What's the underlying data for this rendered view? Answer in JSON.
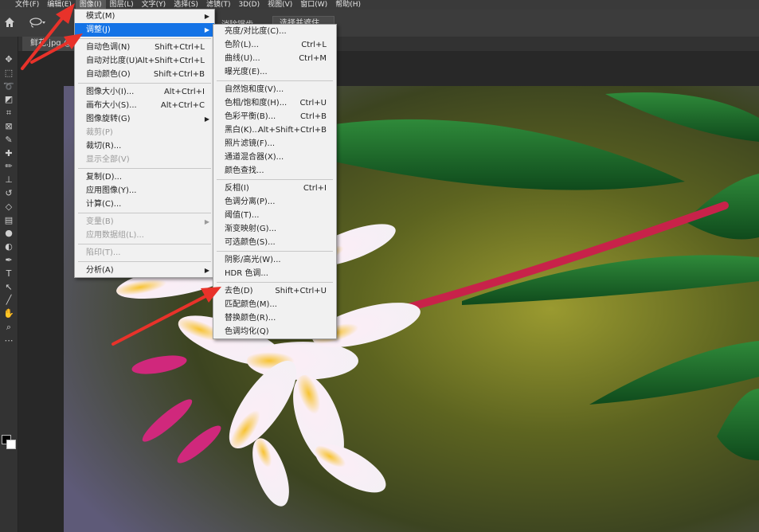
{
  "menubar": {
    "items": [
      "文件(F)",
      "编辑(E)",
      "图像(I)",
      "图层(L)",
      "文字(Y)",
      "选择(S)",
      "滤镜(T)",
      "3D(D)",
      "视图(V)",
      "窗口(W)",
      "帮助(H)"
    ]
  },
  "options_bar": {
    "partial_label": "消除锯齿",
    "select_mask_button": "选择并遮住..."
  },
  "document_tab": {
    "title": "鲜花.jpg @"
  },
  "image_menu": {
    "items": [
      {
        "label": "模式(M)",
        "shortcut": "",
        "submenu": true
      },
      {
        "label": "调整(J)",
        "shortcut": "",
        "submenu": true,
        "highlighted": true
      },
      {
        "sep": true
      },
      {
        "label": "自动色调(N)",
        "shortcut": "Shift+Ctrl+L"
      },
      {
        "label": "自动对比度(U)",
        "shortcut": "Alt+Shift+Ctrl+L"
      },
      {
        "label": "自动颜色(O)",
        "shortcut": "Shift+Ctrl+B"
      },
      {
        "sep": true
      },
      {
        "label": "图像大小(I)...",
        "shortcut": "Alt+Ctrl+I"
      },
      {
        "label": "画布大小(S)...",
        "shortcut": "Alt+Ctrl+C"
      },
      {
        "label": "图像旋转(G)",
        "shortcut": "",
        "submenu": true
      },
      {
        "label": "裁剪(P)",
        "shortcut": "",
        "disabled": true
      },
      {
        "label": "裁切(R)...",
        "shortcut": ""
      },
      {
        "label": "显示全部(V)",
        "shortcut": "",
        "disabled": true
      },
      {
        "sep": true
      },
      {
        "label": "复制(D)...",
        "shortcut": ""
      },
      {
        "label": "应用图像(Y)...",
        "shortcut": ""
      },
      {
        "label": "计算(C)...",
        "shortcut": ""
      },
      {
        "sep": true
      },
      {
        "label": "变量(B)",
        "shortcut": "",
        "submenu": true,
        "disabled": true
      },
      {
        "label": "应用数据组(L)...",
        "shortcut": "",
        "disabled": true
      },
      {
        "sep": true
      },
      {
        "label": "陷印(T)...",
        "shortcut": "",
        "disabled": true
      },
      {
        "sep": true
      },
      {
        "label": "分析(A)",
        "shortcut": "",
        "submenu": true
      }
    ]
  },
  "adjust_menu": {
    "items": [
      {
        "label": "亮度/对比度(C)...",
        "shortcut": ""
      },
      {
        "label": "色阶(L)...",
        "shortcut": "Ctrl+L"
      },
      {
        "label": "曲线(U)...",
        "shortcut": "Ctrl+M"
      },
      {
        "label": "曝光度(E)...",
        "shortcut": ""
      },
      {
        "sep": true
      },
      {
        "label": "自然饱和度(V)...",
        "shortcut": ""
      },
      {
        "label": "色相/饱和度(H)...",
        "shortcut": "Ctrl+U"
      },
      {
        "label": "色彩平衡(B)...",
        "shortcut": "Ctrl+B"
      },
      {
        "label": "黑白(K)...",
        "shortcut": "Alt+Shift+Ctrl+B"
      },
      {
        "label": "照片滤镜(F)...",
        "shortcut": ""
      },
      {
        "label": "通道混合器(X)...",
        "shortcut": ""
      },
      {
        "label": "颜色查找...",
        "shortcut": ""
      },
      {
        "sep": true
      },
      {
        "label": "反相(I)",
        "shortcut": "Ctrl+I"
      },
      {
        "label": "色调分离(P)...",
        "shortcut": ""
      },
      {
        "label": "阈值(T)...",
        "shortcut": ""
      },
      {
        "label": "渐变映射(G)...",
        "shortcut": ""
      },
      {
        "label": "可选颜色(S)...",
        "shortcut": ""
      },
      {
        "sep": true
      },
      {
        "label": "阴影/高光(W)...",
        "shortcut": ""
      },
      {
        "label": "HDR 色调...",
        "shortcut": ""
      },
      {
        "sep": true
      },
      {
        "label": "去色(D)",
        "shortcut": "Shift+Ctrl+U"
      },
      {
        "label": "匹配颜色(M)...",
        "shortcut": ""
      },
      {
        "label": "替换颜色(R)...",
        "shortcut": ""
      },
      {
        "label": "色调均化(Q)",
        "shortcut": ""
      }
    ]
  },
  "colors": {
    "menu_highlight": "#1473e6",
    "annotation_arrow": "#e8322a"
  },
  "tools": [
    "move-icon",
    "marquee-icon",
    "lasso-icon",
    "quick-select-icon",
    "crop-icon",
    "frame-icon",
    "eyedropper-icon",
    "healing-icon",
    "brush-icon",
    "stamp-icon",
    "history-brush-icon",
    "eraser-icon",
    "gradient-icon",
    "blur-icon",
    "dodge-icon",
    "pen-icon",
    "type-icon",
    "path-select-icon",
    "line-icon",
    "hand-icon",
    "zoom-icon",
    "more-icon"
  ]
}
